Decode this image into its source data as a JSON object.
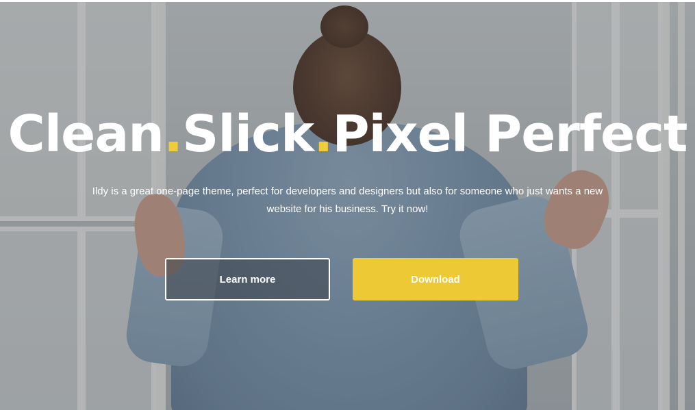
{
  "hero": {
    "title_parts": {
      "word1": "Clean",
      "dot1": ".",
      "word2": "Slick",
      "dot2": ".",
      "word3": "Pixel Perfect"
    },
    "subtitle": "Ildy is a great one-page theme, perfect for developers and designers but also for someone who just wants a new website for his business. Try it now!",
    "buttons": {
      "learn_more": "Learn more",
      "download": "Download"
    }
  },
  "colors": {
    "accent": "#ecc935",
    "title_text": "#ffffff"
  }
}
